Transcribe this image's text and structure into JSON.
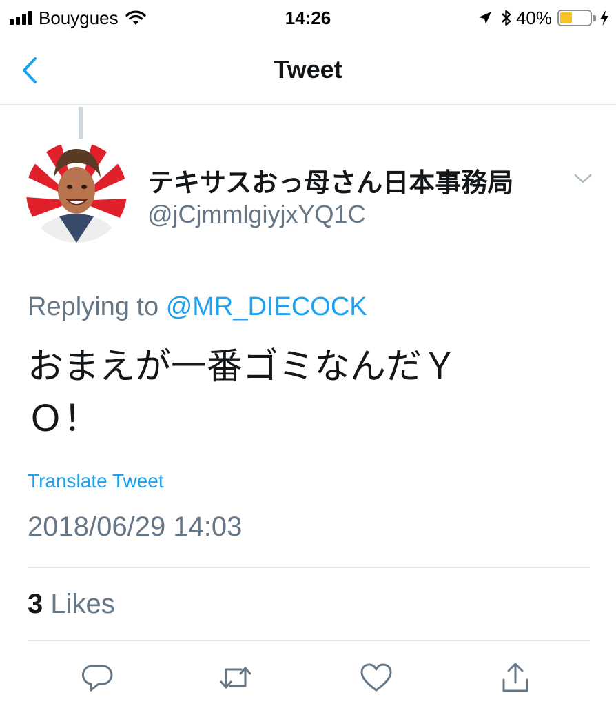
{
  "status_bar": {
    "carrier": "Bouygues",
    "time": "14:26",
    "battery": "40%",
    "battery_level": 0.4,
    "icons": [
      "signal-icon",
      "wifi-icon",
      "location-icon",
      "bluetooth-icon",
      "battery-icon",
      "charging-icon"
    ]
  },
  "nav": {
    "title": "Tweet",
    "back_icon": "chevron-left-icon"
  },
  "tweet": {
    "display_name": "テキサスおっ母さん日本事務局",
    "handle": "@jCjmmlgiyjxYQ1C",
    "replying_prefix": "Replying to",
    "replying_to": "@MR_DIECOCK",
    "text_line1": "おまえが一番ゴミなんだＹ",
    "text_line2": "Ｏ！",
    "translate": "Translate Tweet",
    "timestamp": "2018/06/29 14:03",
    "likes_count": "3",
    "likes_label": "Likes"
  },
  "colors": {
    "accent": "#1da1f2",
    "secondary_text": "#657786",
    "divider": "#e1e8ed",
    "battery": "#f7c325"
  }
}
